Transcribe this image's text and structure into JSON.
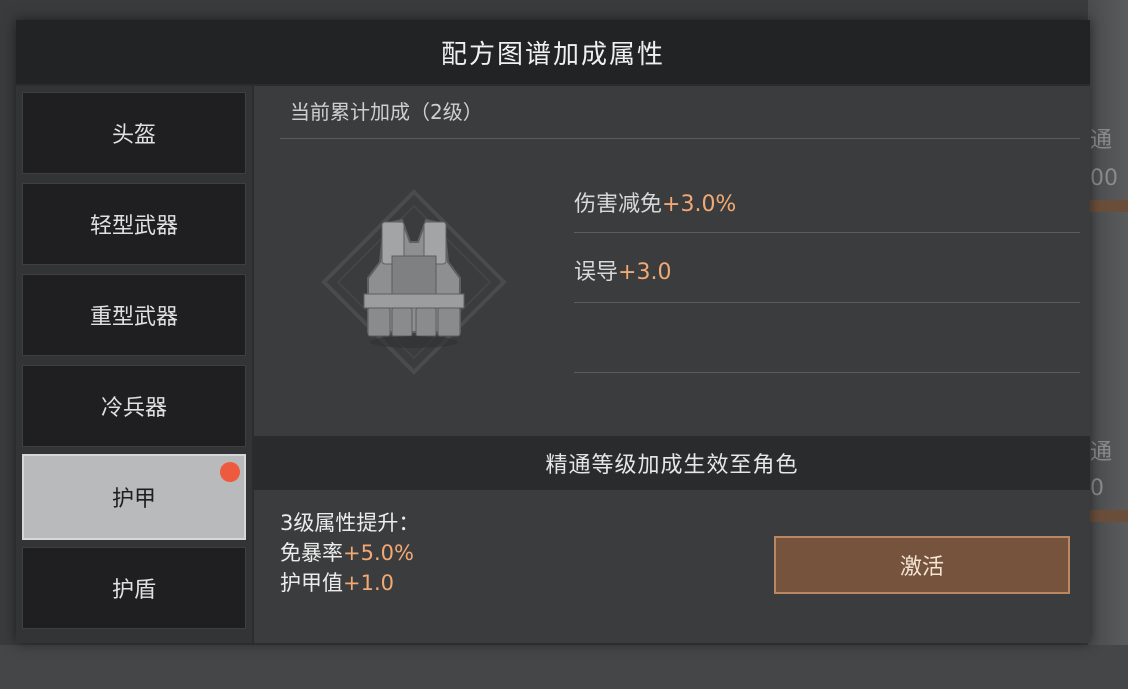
{
  "panel": {
    "title": "配方图谱加成属性"
  },
  "sidebar": {
    "items": [
      {
        "label": "头盔"
      },
      {
        "label": "轻型武器"
      },
      {
        "label": "重型武器"
      },
      {
        "label": "冷兵器"
      },
      {
        "label": "护甲",
        "selected": true,
        "has_notification": true
      },
      {
        "label": "护盾"
      }
    ]
  },
  "current_bonus": {
    "title": "当前累计加成（2级）",
    "item_icon": "body-armor-vest-icon",
    "attributes": [
      {
        "name": "伤害减免",
        "value": "+3.0%"
      },
      {
        "name": "误导",
        "value": "+3.0"
      }
    ]
  },
  "mastery": {
    "banner": "精通等级加成生效至角色"
  },
  "next_level": {
    "heading": "3级属性提升：",
    "attributes": [
      {
        "name": "免暴率",
        "value": "+5.0%"
      },
      {
        "name": "护甲值",
        "value": "+1.0"
      }
    ]
  },
  "activate_button": {
    "label": "激活"
  },
  "background": {
    "ghost_1": "通",
    "ghost_2": "00",
    "ghost_3": "通",
    "ghost_4": "0"
  },
  "colors": {
    "accent_value": "#f2a974",
    "button_bg": "#76533c",
    "badge": "#ee5a3e",
    "selected_tab": "#b9babc"
  }
}
